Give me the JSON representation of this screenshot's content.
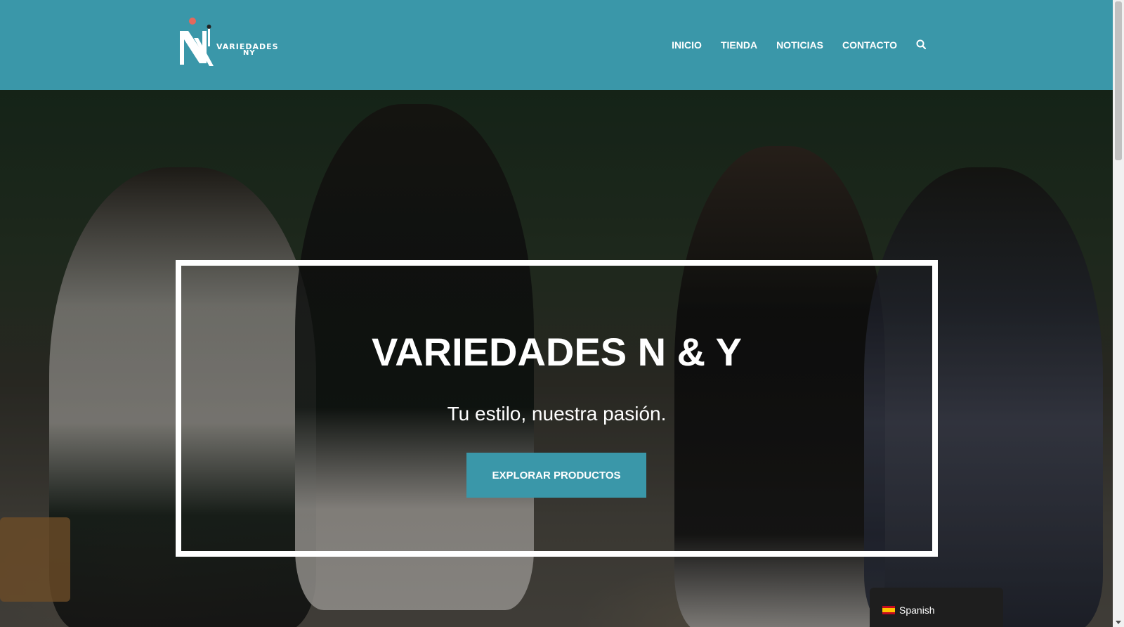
{
  "header": {
    "logo": {
      "line1": "VARIEDADES",
      "line2": "NY"
    },
    "nav": [
      {
        "label": "INICIO"
      },
      {
        "label": "TIENDA"
      },
      {
        "label": "NOTICIAS"
      },
      {
        "label": "CONTACTO"
      }
    ],
    "search_icon": "search-icon"
  },
  "hero": {
    "title": "VARIEDADES N & Y",
    "subtitle": "Tu estilo, nuestra pasión.",
    "cta_label": "EXPLORAR PRODUCTOS"
  },
  "language_switcher": {
    "label": "Spanish",
    "flag": "spain-flag-icon"
  },
  "colors": {
    "brand": "#3a97a9",
    "white": "#ffffff"
  }
}
